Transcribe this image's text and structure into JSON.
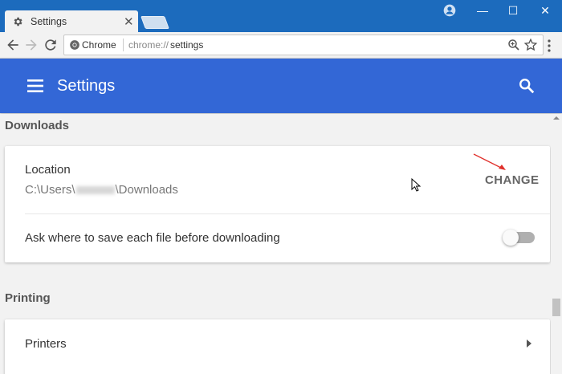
{
  "window": {
    "tab_title": "Settings",
    "tab_close": "✕",
    "profile_icon": "account-circle-icon",
    "minimize": "—",
    "maximize": "☐",
    "close": "✕"
  },
  "toolbar": {
    "site_chip_label": "Chrome",
    "url_scheme": "chrome://",
    "url_path": "settings"
  },
  "header": {
    "title": "Settings"
  },
  "downloads": {
    "section_title": "Downloads",
    "location_label": "Location",
    "location_path_prefix": "C:\\Users\\",
    "location_path_suffix": "\\Downloads",
    "change_button": "CHANGE",
    "ask_label": "Ask where to save each file before downloading",
    "ask_enabled": false
  },
  "printing": {
    "section_title": "Printing",
    "printers_label": "Printers"
  },
  "colors": {
    "titlebar": "#1c6bbd",
    "header": "#3367d6",
    "annotation_arrow": "#e0312c"
  }
}
